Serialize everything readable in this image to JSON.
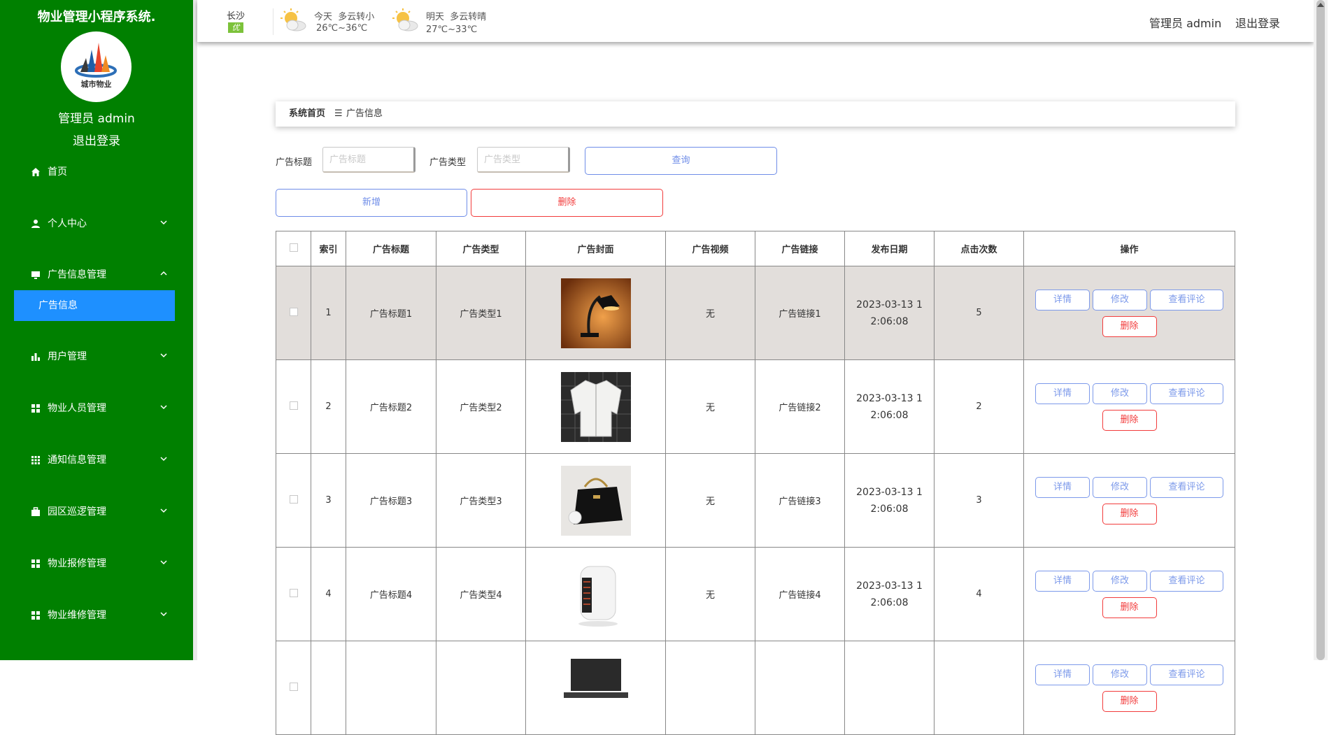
{
  "app": {
    "title": "物业管理小程序系统.",
    "logo_text": "城市物业",
    "user": "管理员 admin",
    "logout": "退出登录"
  },
  "sidebar": {
    "items": [
      {
        "label": "首页",
        "icon": "home-icon"
      },
      {
        "label": "个人中心",
        "icon": "user-icon"
      },
      {
        "label": "广告信息管理",
        "icon": "monitor-icon"
      },
      {
        "label": "用户管理",
        "icon": "bar-chart-icon"
      },
      {
        "label": "物业人员管理",
        "icon": "grid-icon"
      },
      {
        "label": "通知信息管理",
        "icon": "apps-icon"
      },
      {
        "label": "园区巡逻管理",
        "icon": "briefcase-icon"
      },
      {
        "label": "物业报修管理",
        "icon": "grid-icon"
      },
      {
        "label": "物业维修管理",
        "icon": "grid-icon"
      }
    ],
    "active_sub": "广告信息"
  },
  "header": {
    "city": "长沙",
    "aqi": "优",
    "today": {
      "label": "今天",
      "desc": "多云转小",
      "temp": "26℃~36℃"
    },
    "tomorrow": {
      "label": "明天",
      "desc": "多云转晴",
      "temp": "27℃~33℃"
    },
    "user": "管理员 admin",
    "logout": "退出登录"
  },
  "breadcrumb": {
    "home": "系统首页",
    "sep": "☰",
    "current": "广告信息"
  },
  "search": {
    "title_label": "广告标题",
    "title_placeholder": "广告标题",
    "type_label": "广告类型",
    "type_placeholder": "广告类型",
    "query_button": "查询"
  },
  "actions": {
    "add": "新增",
    "delete": "删除"
  },
  "table": {
    "columns": [
      "索引",
      "广告标题",
      "广告类型",
      "广告封面",
      "广告视频",
      "广告链接",
      "发布日期",
      "点击次数",
      "操作"
    ],
    "rows": [
      {
        "index": "1",
        "title": "广告标题1",
        "type": "广告类型1",
        "cover": "desk-lamp",
        "video": "无",
        "link": "广告链接1",
        "date": "2023-03-13 12:06:08",
        "clicks": "5"
      },
      {
        "index": "2",
        "title": "广告标题2",
        "type": "广告类型2",
        "cover": "white-jacket",
        "video": "无",
        "link": "广告链接2",
        "date": "2023-03-13 12:06:08",
        "clicks": "2"
      },
      {
        "index": "3",
        "title": "广告标题3",
        "type": "广告类型3",
        "cover": "black-handbag",
        "video": "无",
        "link": "广告链接3",
        "date": "2023-03-13 12:06:08",
        "clicks": "3"
      },
      {
        "index": "4",
        "title": "广告标题4",
        "type": "广告类型4",
        "cover": "space-heater",
        "video": "无",
        "link": "广告链接4",
        "date": "2023-03-13 12:06:08",
        "clicks": "4"
      },
      {
        "index": "",
        "title": "",
        "type": "",
        "cover": "laptop",
        "video": "",
        "link": "",
        "date": "",
        "clicks": ""
      }
    ],
    "row_actions": {
      "detail": "详情",
      "edit": "修改",
      "comments": "查看评论",
      "delete": "删除"
    }
  },
  "colors": {
    "sidebar": "#008000",
    "active": "#1e90ff",
    "primary": "#6f8de8",
    "danger": "#f23c3c",
    "highlight_row": "#e2dedb"
  }
}
